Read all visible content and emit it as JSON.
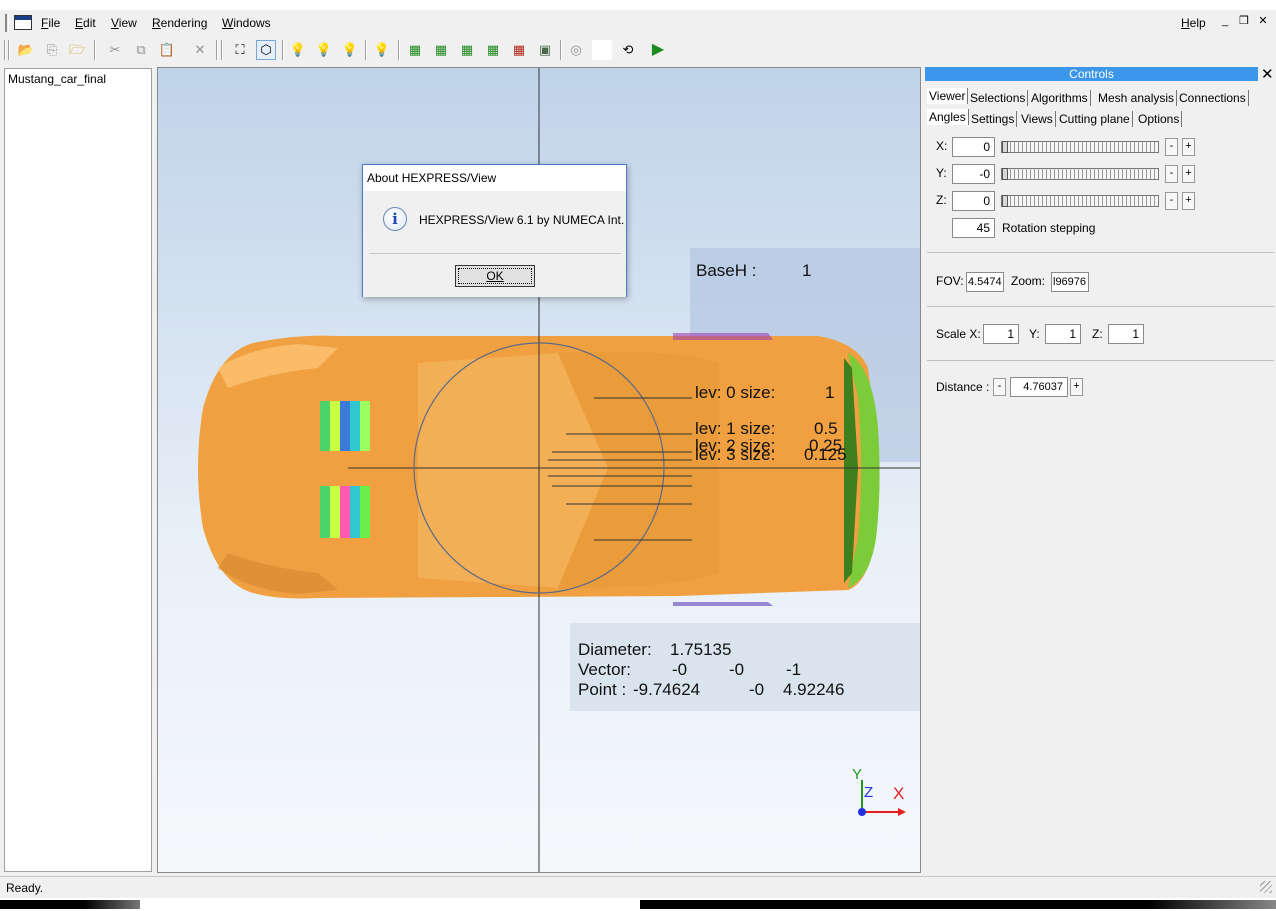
{
  "menu": {
    "file": "File",
    "edit": "Edit",
    "view": "View",
    "rendering": "Rendering",
    "windows": "Windows",
    "help": "Help"
  },
  "tree": {
    "item": "Mustang_car_final"
  },
  "viewport": {
    "baseh_label": "BaseH :",
    "baseh_value": "1",
    "levels": [
      {
        "label": "lev: 0 size:",
        "value": "1"
      },
      {
        "label": "lev: 1 size:",
        "value": "0.5"
      },
      {
        "label": "lev: 2 size:",
        "value": "0.25"
      },
      {
        "label": "lev: 3 size:",
        "value": "0.125"
      }
    ],
    "diameter_label": "Diameter:",
    "diameter_value": "1.75135",
    "vector_label": "Vector:",
    "vector_x": "-0",
    "vector_y": "-0",
    "vector_z": "-1",
    "point_label": "Point :",
    "point_x": "-9.74624",
    "point_y": "-0",
    "point_z": "4.92246",
    "axis_y": "Y",
    "axis_z": "Z",
    "axis_x": "X"
  },
  "dialog": {
    "title": "About HEXPRESS/View",
    "message": "HEXPRESS/View 6.1 by NUMECA Int.",
    "ok": "OK"
  },
  "controls": {
    "header": "Controls",
    "tabs_row1": [
      "Viewer",
      "Selections",
      "Algorithms",
      "Mesh analysis",
      "Connections"
    ],
    "tabs_row2": [
      "Angles",
      "Settings",
      "Views",
      "Cutting plane",
      "Options"
    ],
    "x_label": "X:",
    "x_value": "0",
    "y_label": "Y:",
    "y_value": "-0",
    "z_label": "Z:",
    "z_value": "0",
    "minus": "-",
    "plus": "+",
    "rotation_value": "45",
    "rotation_label": "Rotation stepping",
    "fov_label": "FOV:",
    "fov_value": "4.5474",
    "zoom_label": "Zoom:",
    "zoom_value": "l96976",
    "scale_label": "Scale X:",
    "scale_x": "1",
    "scale_y_label": "Y:",
    "scale_y": "1",
    "scale_z_label": "Z:",
    "scale_z": "1",
    "distance_label": "Distance :",
    "distance_value": "4.76037"
  },
  "status": {
    "text": "Ready."
  },
  "colors": {
    "car": "#f0a040",
    "car_dark": "#c9782a",
    "rear": "#7ccc3a",
    "highlight": "#3c97ea"
  }
}
